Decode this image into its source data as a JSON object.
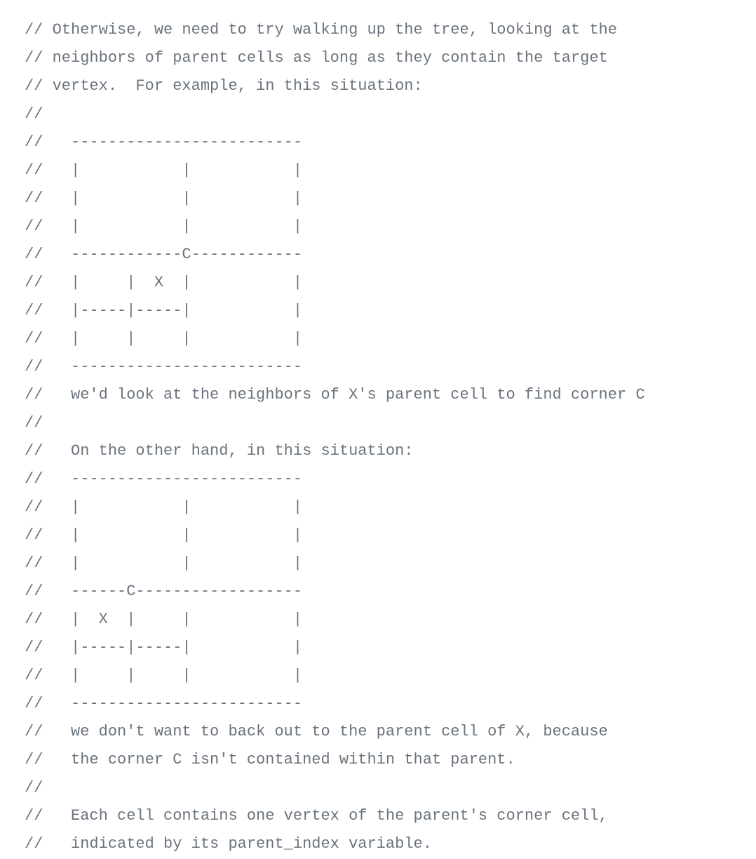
{
  "code": {
    "language": "comment",
    "text_color": "#6a737d",
    "lines": [
      "// Otherwise, we need to try walking up the tree, looking at the",
      "// neighbors of parent cells as long as they contain the target",
      "// vertex.  For example, in this situation:",
      "//",
      "//   -------------------------",
      "//   |           |           |",
      "//   |           |           |",
      "//   |           |           |",
      "//   ------------C------------",
      "//   |     |  X  |           |",
      "//   |-----|-----|           |",
      "//   |     |     |           |",
      "//   -------------------------",
      "//   we'd look at the neighbors of X's parent cell to find corner C",
      "//",
      "//   On the other hand, in this situation:",
      "//   -------------------------",
      "//   |           |           |",
      "//   |           |           |",
      "//   |           |           |",
      "//   ------C------------------",
      "//   |  X  |     |           |",
      "//   |-----|-----|           |",
      "//   |     |     |           |",
      "//   -------------------------",
      "//   we don't want to back out to the parent cell of X, because",
      "//   the corner C isn't contained within that parent.",
      "//",
      "//   Each cell contains one vertex of the parent's corner cell,",
      "//   indicated by its parent_index variable."
    ]
  }
}
